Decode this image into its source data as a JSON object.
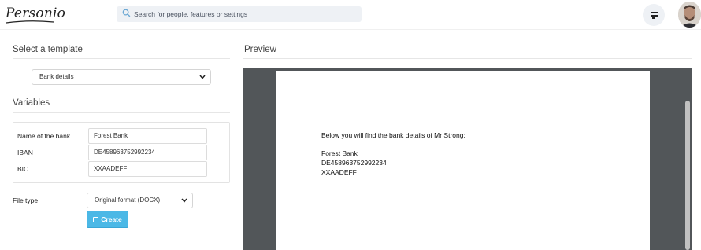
{
  "header": {
    "logo_text": "Personio",
    "search_placeholder": "Search for people, features or settings",
    "filter_icon": "filter-lines-icon",
    "avatar_icon": "user-avatar"
  },
  "template_section": {
    "title": "Select a template",
    "selected_template": "Bank details"
  },
  "variables_section": {
    "title": "Variables",
    "fields": [
      {
        "label": "Name of the bank",
        "value": "Forest Bank"
      },
      {
        "label": "IBAN",
        "value": "DE458963752992234"
      },
      {
        "label": "BIC",
        "value": "XXAADEFF"
      }
    ]
  },
  "file_type": {
    "label": "File type",
    "selected": "Original format (DOCX)"
  },
  "create_button": {
    "label": "Create",
    "icon": "floppy-disk-icon"
  },
  "preview": {
    "title": "Preview",
    "lines": [
      "Below you will find the bank details of Mr Strong:",
      "Forest Bank",
      "DE458963752992234",
      "XXAADEFF"
    ]
  },
  "colors": {
    "accent": "#4bb8e6",
    "preview_background": "#525659",
    "search_background": "#eef1f5"
  }
}
